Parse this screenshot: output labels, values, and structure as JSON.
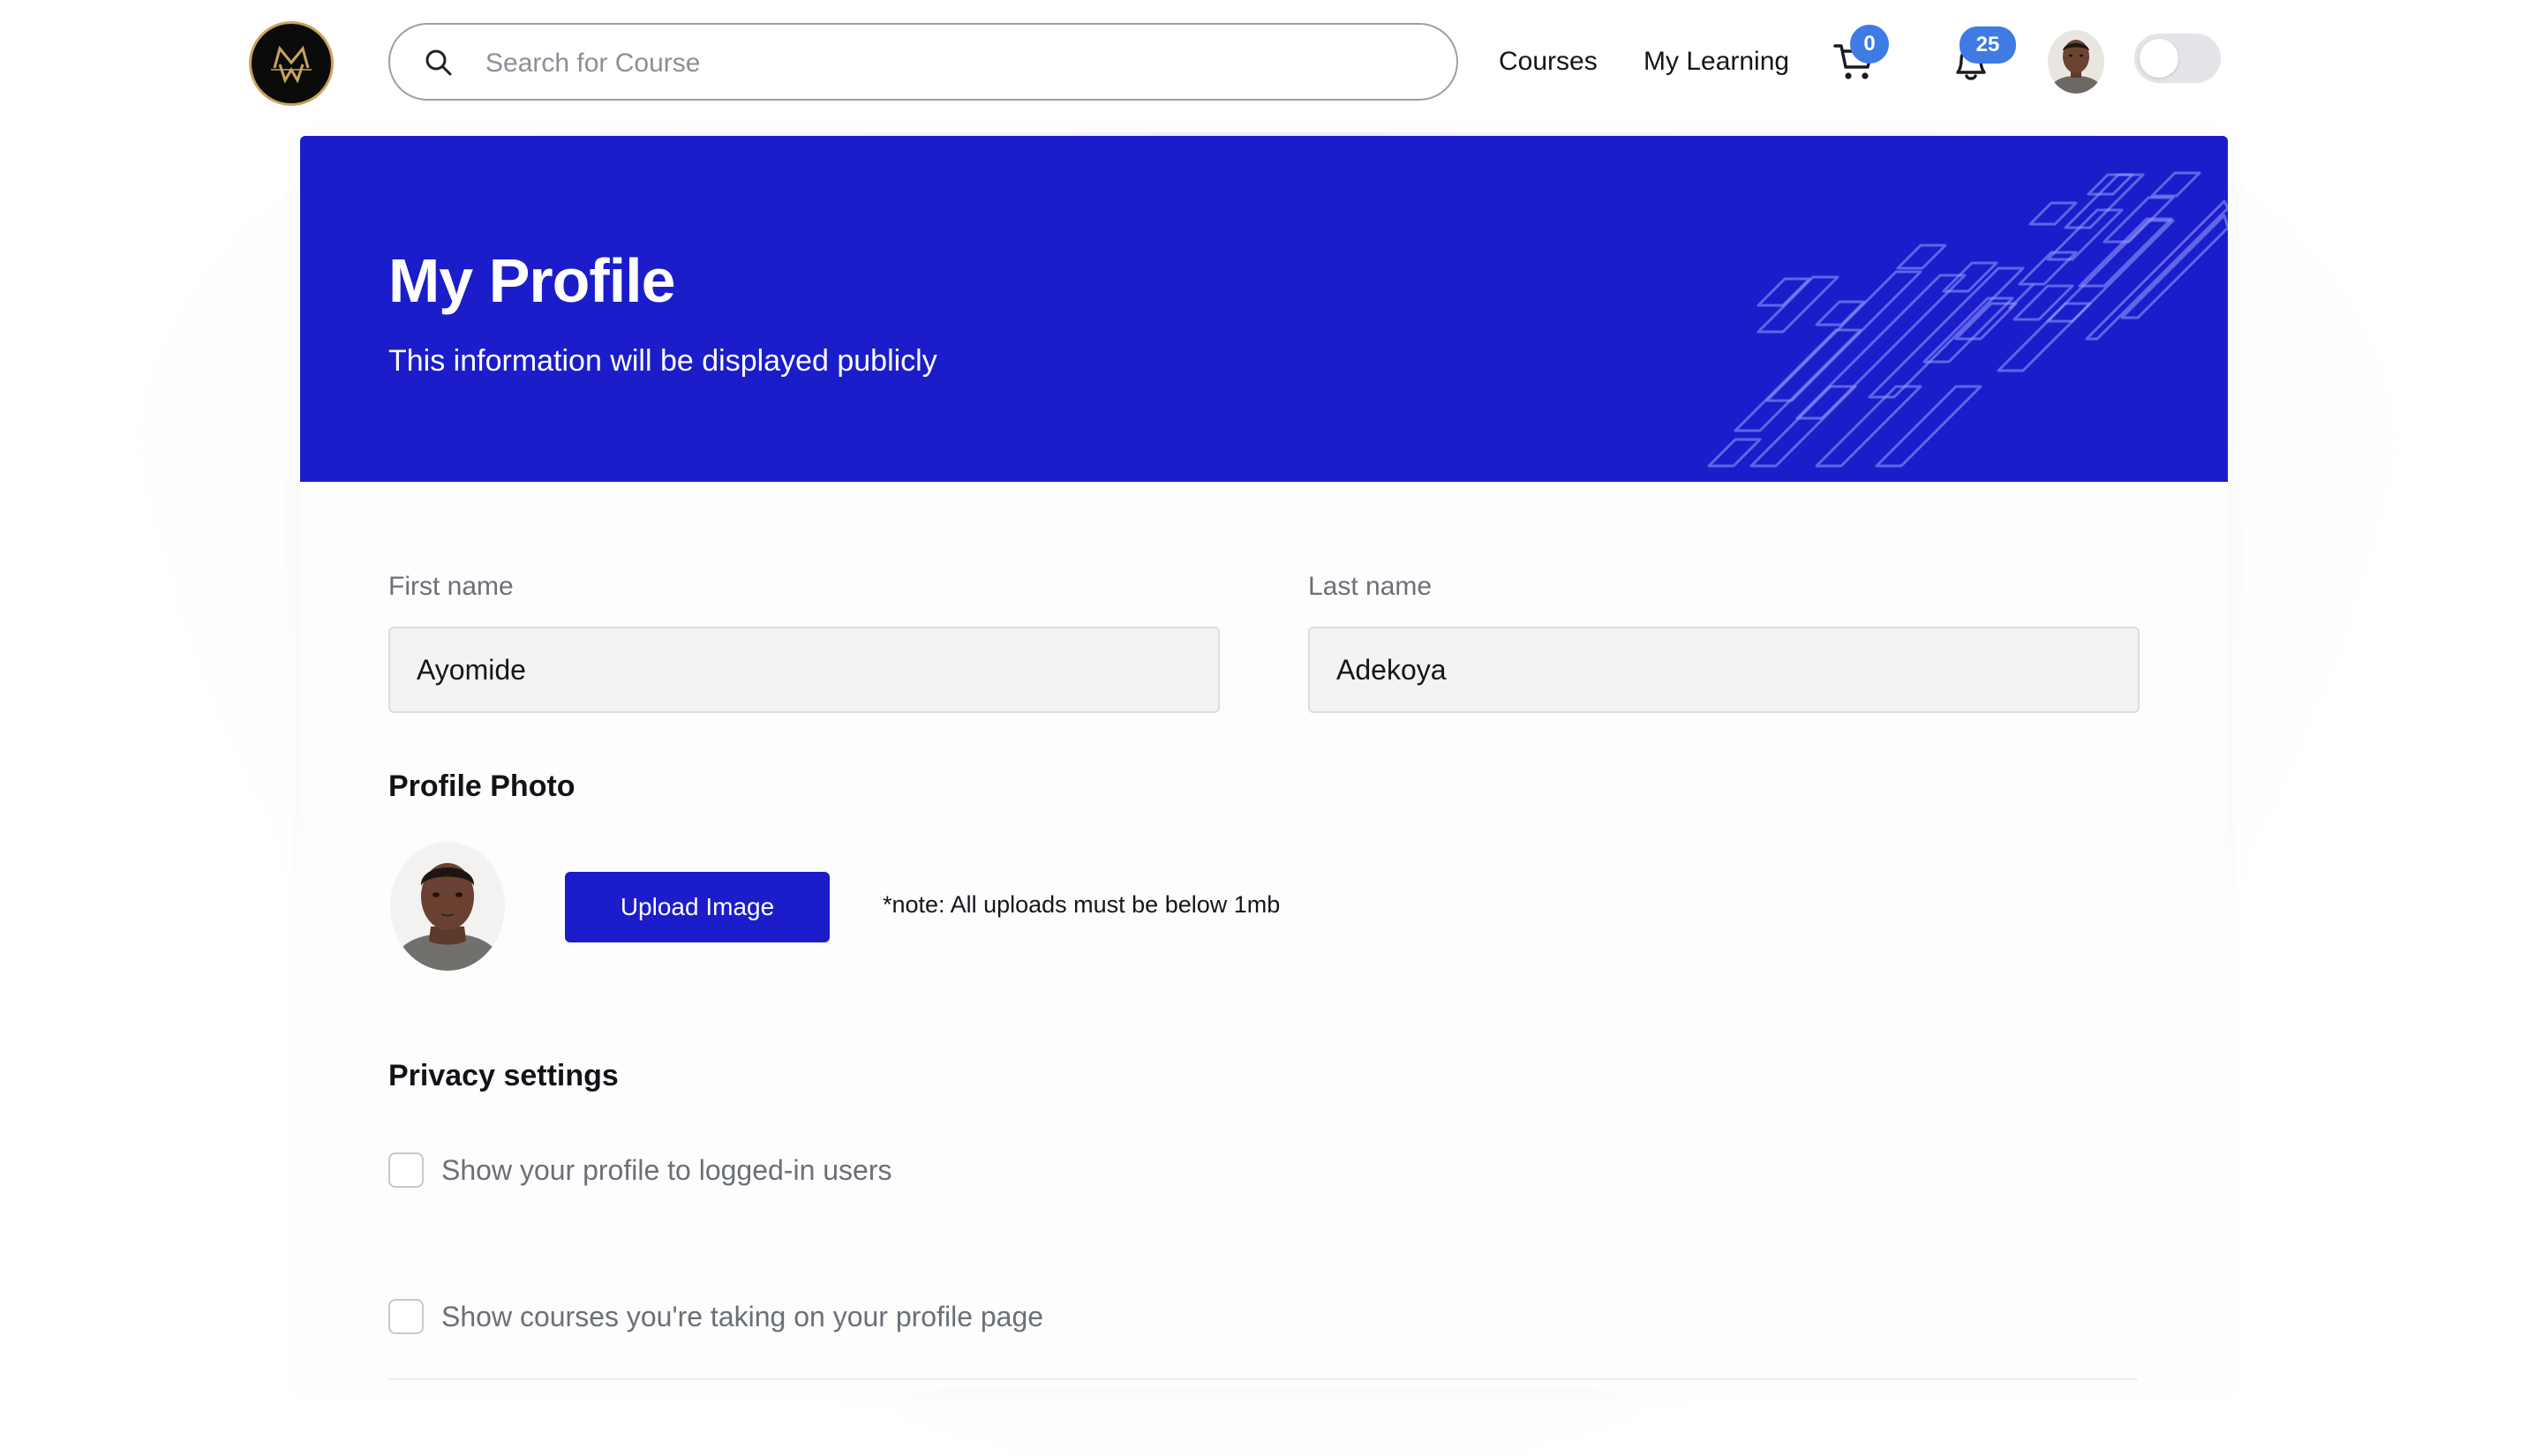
{
  "header": {
    "search": {
      "placeholder": "Search for Course",
      "value": ""
    },
    "nav": {
      "courses": "Courses",
      "my_learning": "My Learning"
    },
    "cart_count": "0",
    "notification_count": "25",
    "theme_toggle_on": false
  },
  "banner": {
    "title": "My Profile",
    "subtitle": "This information will be displayed publicly",
    "color": "#1b1dca"
  },
  "form": {
    "first_name": {
      "label": "First name",
      "value": "Ayomide"
    },
    "last_name": {
      "label": "Last name",
      "value": "Adekoya"
    },
    "profile_photo": {
      "title": "Profile Photo",
      "upload_label": "Upload Image",
      "note": "*note: All uploads must be below 1mb"
    },
    "privacy": {
      "title": "Privacy settings",
      "options": [
        {
          "label": "Show your profile to logged-in users",
          "checked": false
        },
        {
          "label": "Show courses you're taking on your profile page",
          "checked": false
        }
      ]
    }
  },
  "icons": [
    "logo",
    "search-icon",
    "cart-icon",
    "bell-icon",
    "avatar",
    "theme-toggle"
  ]
}
